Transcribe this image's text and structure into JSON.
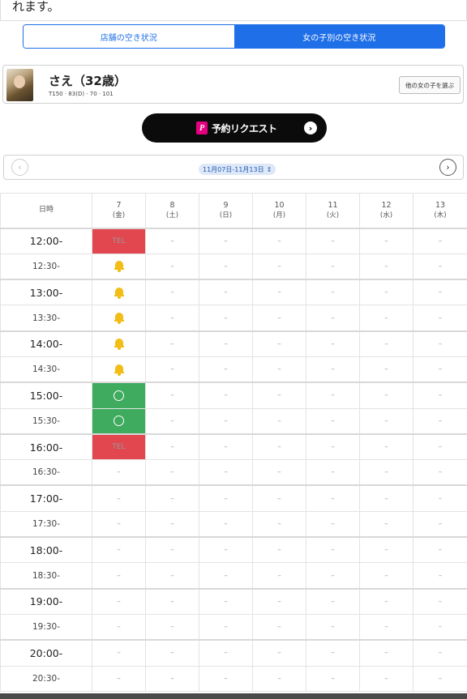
{
  "top_text": "れます。",
  "tabs": [
    {
      "label": "店舗の空き状況",
      "active": false
    },
    {
      "label": "女の子別の空き状況",
      "active": true
    }
  ],
  "profile": {
    "name": "さえ（32歳）",
    "stats": "T150 · 83(D) · 70 · 101",
    "other_button": "他の女の子を選ぶ"
  },
  "reserve": {
    "icon_letter": "P",
    "label": "予約リクエスト",
    "arrow": "›"
  },
  "week_nav": {
    "prev": "‹",
    "next": "›",
    "range": "11月07日-11月13日",
    "range_icon": "⇕"
  },
  "table": {
    "time_header": "日時",
    "days": [
      {
        "num": "7",
        "wd": "(金)",
        "kind": "weekday"
      },
      {
        "num": "8",
        "wd": "(土)",
        "kind": "sat"
      },
      {
        "num": "9",
        "wd": "(日)",
        "kind": "sun"
      },
      {
        "num": "10",
        "wd": "(月)",
        "kind": "weekday"
      },
      {
        "num": "11",
        "wd": "(火)",
        "kind": "weekday"
      },
      {
        "num": "12",
        "wd": "(水)",
        "kind": "weekday"
      },
      {
        "num": "13",
        "wd": "(木)",
        "kind": "weekday"
      }
    ],
    "rows": [
      {
        "time": "12:00-",
        "major": true,
        "cells": [
          "TEL",
          "–",
          "–",
          "–",
          "–",
          "–",
          "–"
        ]
      },
      {
        "time": "12:30-",
        "major": false,
        "cells": [
          "bell",
          "–",
          "–",
          "–",
          "–",
          "–",
          "–"
        ]
      },
      {
        "time": "13:00-",
        "major": true,
        "cells": [
          "bell",
          "–",
          "–",
          "–",
          "–",
          "–",
          "–"
        ]
      },
      {
        "time": "13:30-",
        "major": false,
        "cells": [
          "bell",
          "–",
          "–",
          "–",
          "–",
          "–",
          "–"
        ]
      },
      {
        "time": "14:00-",
        "major": true,
        "cells": [
          "bell",
          "–",
          "–",
          "–",
          "–",
          "–",
          "–"
        ]
      },
      {
        "time": "14:30-",
        "major": false,
        "cells": [
          "bell",
          "–",
          "–",
          "–",
          "–",
          "–",
          "–"
        ]
      },
      {
        "time": "15:00-",
        "major": true,
        "cells": [
          "ok",
          "–",
          "–",
          "–",
          "–",
          "–",
          "–"
        ]
      },
      {
        "time": "15:30-",
        "major": false,
        "cells": [
          "ok",
          "–",
          "–",
          "–",
          "–",
          "–",
          "–"
        ]
      },
      {
        "time": "16:00-",
        "major": true,
        "cells": [
          "TEL",
          "–",
          "–",
          "–",
          "–",
          "–",
          "–"
        ]
      },
      {
        "time": "16:30-",
        "major": false,
        "cells": [
          "–",
          "–",
          "–",
          "–",
          "–",
          "–",
          "–"
        ]
      },
      {
        "time": "17:00-",
        "major": true,
        "cells": [
          "–",
          "–",
          "–",
          "–",
          "–",
          "–",
          "–"
        ]
      },
      {
        "time": "17:30-",
        "major": false,
        "cells": [
          "–",
          "–",
          "–",
          "–",
          "–",
          "–",
          "–"
        ]
      },
      {
        "time": "18:00-",
        "major": true,
        "cells": [
          "–",
          "–",
          "–",
          "–",
          "–",
          "–",
          "–"
        ]
      },
      {
        "time": "18:30-",
        "major": false,
        "cells": [
          "–",
          "–",
          "–",
          "–",
          "–",
          "–",
          "–"
        ]
      },
      {
        "time": "19:00-",
        "major": true,
        "cells": [
          "–",
          "–",
          "–",
          "–",
          "–",
          "–",
          "–"
        ]
      },
      {
        "time": "19:30-",
        "major": false,
        "cells": [
          "–",
          "–",
          "–",
          "–",
          "–",
          "–",
          "–"
        ]
      },
      {
        "time": "20:00-",
        "major": true,
        "cells": [
          "–",
          "–",
          "–",
          "–",
          "–",
          "–",
          "–"
        ]
      },
      {
        "time": "20:30-",
        "major": false,
        "cells": [
          "–",
          "–",
          "–",
          "–",
          "–",
          "–",
          "–"
        ]
      }
    ]
  },
  "colors": {
    "accent_blue": "#1e6fe8",
    "tel_red": "#e2464f",
    "available_green": "#3fab5f",
    "bell_yellow": "#f2bd14",
    "saturday_blue": "#2a3f9e",
    "sunday_red": "#d33b3b"
  }
}
